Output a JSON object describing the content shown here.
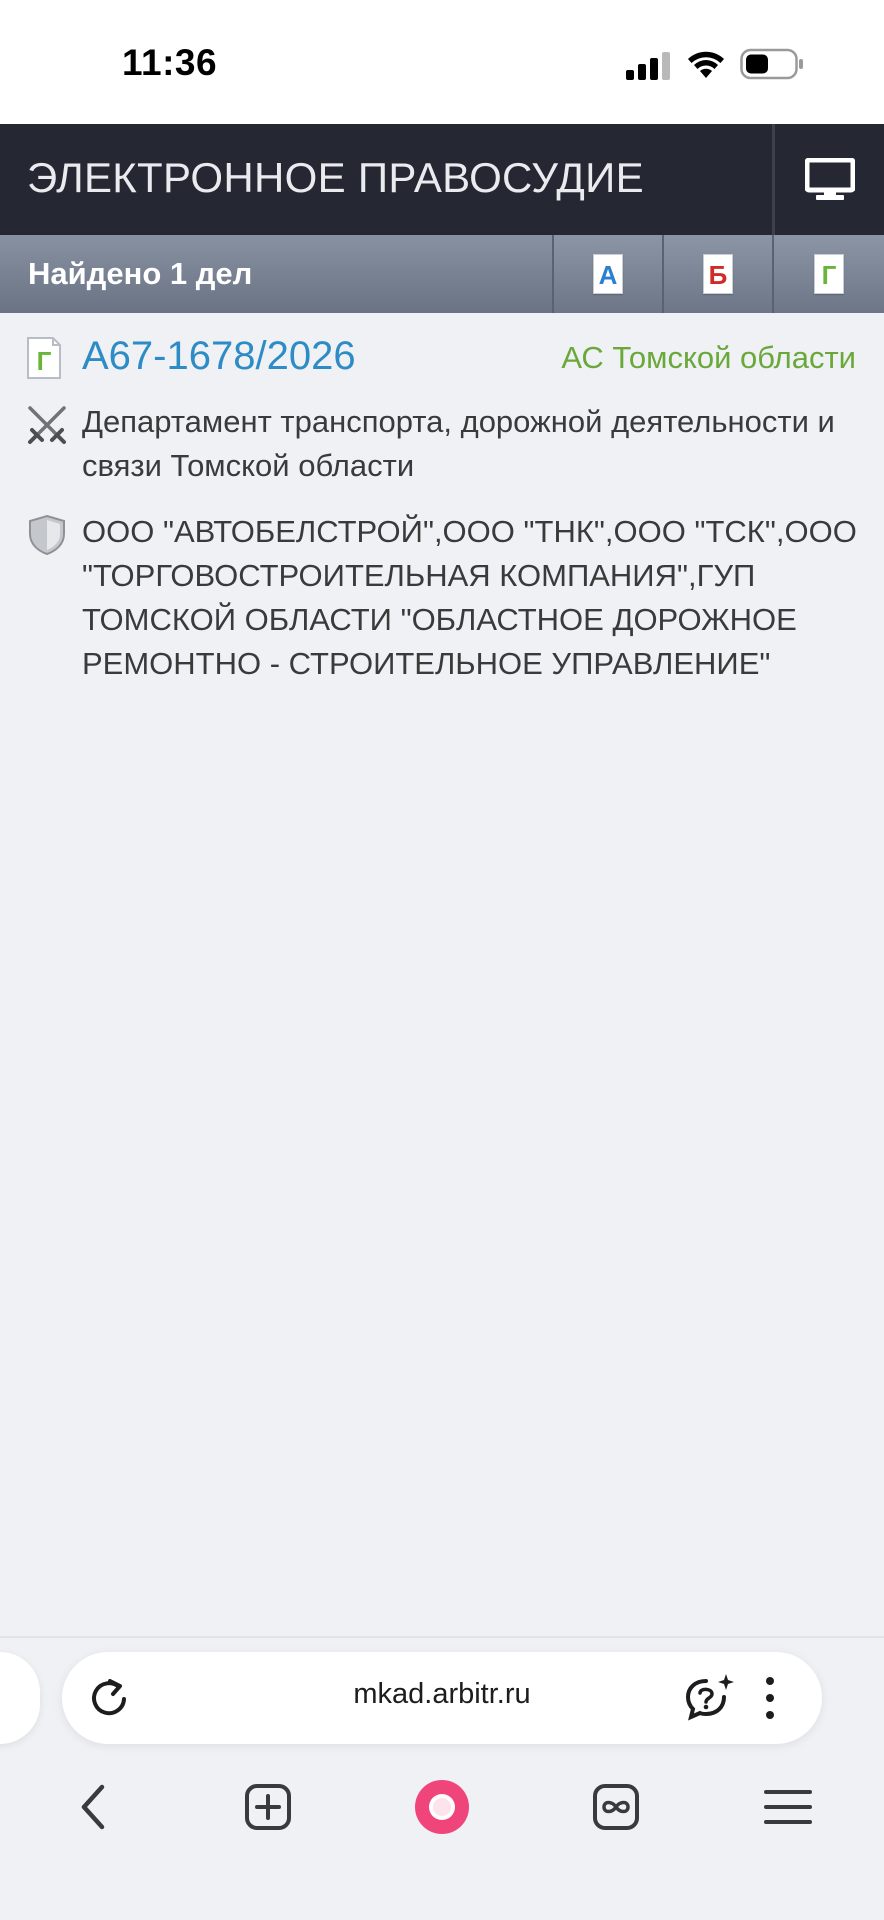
{
  "status_bar": {
    "time": "11:36",
    "icons": [
      "signal-icon",
      "wifi-icon",
      "battery-icon"
    ]
  },
  "header": {
    "title": "ЭЛЕКТРОННОЕ ПРАВОСУДИЕ",
    "desktop_icon": "monitor-icon"
  },
  "results_bar": {
    "found_label": "Найдено 1 дел",
    "filters": [
      {
        "letter": "А",
        "color": "#2a7fd0"
      },
      {
        "letter": "Б",
        "color": "#d02a2a"
      },
      {
        "letter": "Г",
        "color": "#6ab43a"
      }
    ]
  },
  "case": {
    "type_icon_letter": "Г",
    "type_icon_color": "#6ab43a",
    "number": "А67-1678/2026",
    "court": "АС Томской области",
    "plaintiff": "Департамент транспорта, дорожной деятельности и связи Томской области",
    "respondent": "ООО \"АВТОБЕЛСТРОЙ\",ООО \"ТНК\",ООО \"ТСК\",ООО \"ТОРГОВОСТРОИТЕЛЬНАЯ КОМПАНИЯ\",ГУП ТОМСКОЙ ОБЛАСТИ \"ОБЛАСТНОЕ ДОРОЖНОЕ РЕМОНТНО - СТРОИТЕЛЬНОЕ УПРАВЛЕНИЕ\"",
    "plaintiff_icon": "crossed-swords-icon",
    "respondent_icon": "shield-icon"
  },
  "browser": {
    "url": "mkad.arbitr.ru",
    "reload_icon": "reload-icon",
    "ai_icon": "ai-chat-icon",
    "menu_icon": "more-vertical-icon",
    "brand_color": "#f0457a",
    "nav": [
      "back-icon",
      "new-tab-icon",
      "alice-icon",
      "tabs-icon",
      "menu-icon"
    ]
  }
}
